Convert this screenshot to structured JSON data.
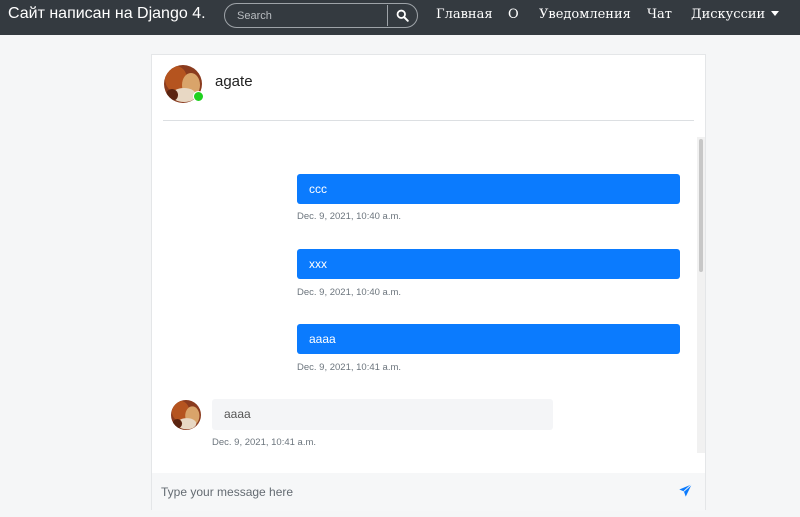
{
  "navbar": {
    "brand": "Сайт написан на Django 4.",
    "search_placeholder": "Search",
    "search_icon": "search-icon",
    "links": [
      "Главная",
      "О",
      "Уведомления",
      "Чат",
      "Дискуссии"
    ],
    "dropdown_icon": "caret-down-icon"
  },
  "chat": {
    "partner_name": "agate",
    "online": true,
    "messages": [
      {
        "direction": "outgoing",
        "text": "ccc",
        "time": "Dec. 9, 2021, 10:40 a.m."
      },
      {
        "direction": "outgoing",
        "text": "xxx",
        "time": "Dec. 9, 2021, 10:40 a.m."
      },
      {
        "direction": "outgoing",
        "text": "aaaa",
        "time": "Dec. 9, 2021, 10:41 a.m."
      },
      {
        "direction": "incoming",
        "text": "aaaa",
        "time": "Dec. 9, 2021, 10:41 a.m."
      }
    ],
    "composer_placeholder": "Type your message here",
    "send_icon": "paper-plane-icon"
  },
  "colors": {
    "navbar_bg": "#343a40",
    "outgoing_bubble": "#0b7bfe",
    "incoming_bubble": "#f4f5f7",
    "online_dot": "#1fd11f"
  }
}
